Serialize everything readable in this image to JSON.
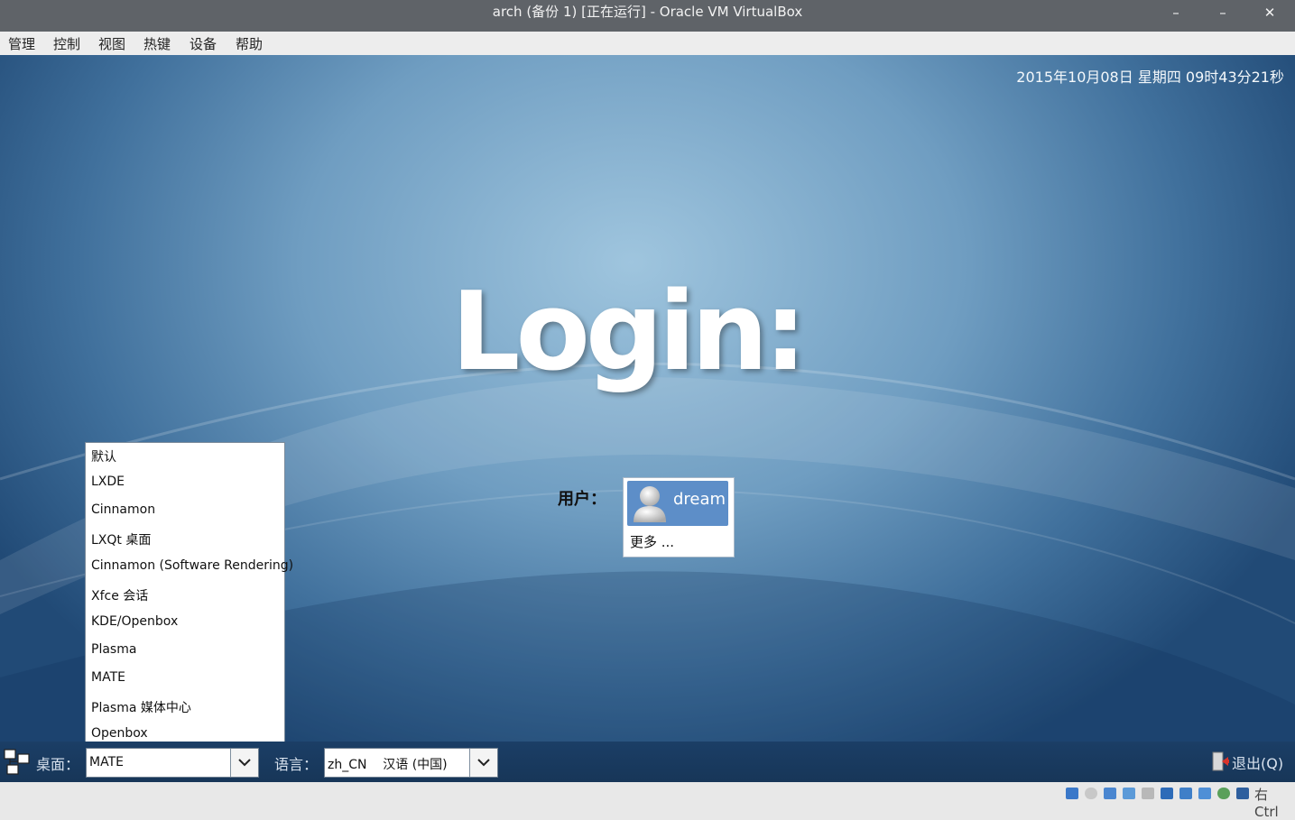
{
  "window": {
    "title": "arch (备份 1) [正在运行] - Oracle VM VirtualBox",
    "minimize_glyph": "–",
    "maximize_glyph": "–",
    "close_glyph": "✕"
  },
  "menu": {
    "items": [
      "管理",
      "控制",
      "视图",
      "热键",
      "设备",
      "帮助"
    ]
  },
  "login": {
    "datetime": "2015年10月08日 星期四 09时43分21秒",
    "logo_text": "Login:",
    "user_label": "用户：",
    "selected_user": "dream",
    "more_label": "更多 ..."
  },
  "desktop_menu": {
    "options": [
      "默认",
      "LXDE",
      "Cinnamon",
      "LXQt 桌面",
      "Cinnamon (Software Rendering)",
      "Xfce 会话",
      "KDE/Openbox",
      "Plasma",
      "MATE",
      "Plasma 媒体中心",
      "Openbox"
    ]
  },
  "bottom_bar": {
    "desktop_label": "桌面：",
    "desktop_value": "MATE",
    "language_label": "语言：",
    "language_value": "zh_CN    汉语 (中国)",
    "quit_label": "退出(Q)"
  },
  "statusbar": {
    "host_key": "右 Ctrl",
    "icons": [
      "hard-disk-icon",
      "optical-drive-icon",
      "audio-icon",
      "usb-icon",
      "shared-folders-icon",
      "display-icon",
      "screen-capture-icon",
      "network-icon",
      "video-capture-icon",
      "cpu-virtualization-icon",
      "mouse-integration-icon"
    ]
  },
  "colors": {
    "selection": "#5d8ec8",
    "bottom_bar": "#1b3e66",
    "titlebar": "#5f6368"
  }
}
